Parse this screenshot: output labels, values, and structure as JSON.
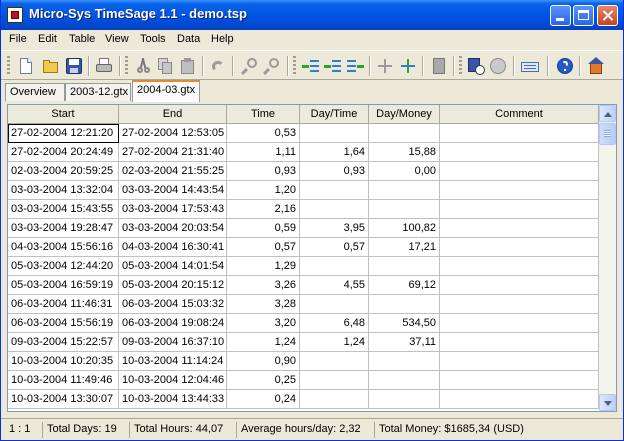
{
  "window": {
    "title": "Micro-Sys TimeSage 1.1 - demo.tsp"
  },
  "menu": [
    "File",
    "Edit",
    "Table",
    "View",
    "Tools",
    "Data",
    "Help"
  ],
  "toolbar": {
    "buttons": [
      "new-file",
      "open-folder",
      "save",
      "print",
      "cut",
      "copy",
      "paste",
      "undo",
      "find",
      "replace",
      "insert-row-before",
      "insert-row",
      "insert-row-after",
      "merge-rows",
      "split-row",
      "notes",
      "calculator-clock",
      "stop",
      "keyboard",
      "help",
      "home"
    ]
  },
  "tabs": [
    {
      "label": "Overview",
      "active": false
    },
    {
      "label": "2003-12.gtx",
      "active": false
    },
    {
      "label": "2004-03.gtx",
      "active": true
    }
  ],
  "table": {
    "columns": [
      "Start",
      "End",
      "Time",
      "Day/Time",
      "Day/Money",
      "Comment"
    ],
    "rows": [
      [
        "27-02-2004 12:21:20",
        "27-02-2004 12:53:05",
        "0,53",
        "",
        "",
        ""
      ],
      [
        "27-02-2004 20:24:49",
        "27-02-2004 21:31:40",
        "1,11",
        "1,64",
        "15,88",
        ""
      ],
      [
        "02-03-2004 20:59:25",
        "02-03-2004 21:55:25",
        "0,93",
        "0,93",
        "0,00",
        ""
      ],
      [
        "03-03-2004 13:32:04",
        "03-03-2004 14:43:54",
        "1,20",
        "",
        "",
        ""
      ],
      [
        "03-03-2004 15:43:55",
        "03-03-2004 17:53:43",
        "2,16",
        "",
        "",
        ""
      ],
      [
        "03-03-2004 19:28:47",
        "03-03-2004 20:03:54",
        "0,59",
        "3,95",
        "100,82",
        ""
      ],
      [
        "04-03-2004 15:56:16",
        "04-03-2004 16:30:41",
        "0,57",
        "0,57",
        "17,21",
        ""
      ],
      [
        "05-03-2004 12:44:20",
        "05-03-2004 14:01:54",
        "1,29",
        "",
        "",
        ""
      ],
      [
        "05-03-2004 16:59:19",
        "05-03-2004 20:15:12",
        "3,26",
        "4,55",
        "69,12",
        ""
      ],
      [
        "06-03-2004 11:46:31",
        "06-03-2004 15:03:32",
        "3,28",
        "",
        "",
        ""
      ],
      [
        "06-03-2004 15:56:19",
        "06-03-2004 19:08:24",
        "3,20",
        "6,48",
        "534,50",
        ""
      ],
      [
        "09-03-2004 15:22:57",
        "09-03-2004 16:37:10",
        "1,24",
        "1,24",
        "37,11",
        ""
      ],
      [
        "10-03-2004 10:20:35",
        "10-03-2004 11:14:24",
        "0,90",
        "",
        "",
        ""
      ],
      [
        "10-03-2004 11:49:46",
        "10-03-2004 12:04:46",
        "0,25",
        "",
        "",
        ""
      ],
      [
        "10-03-2004 13:30:07",
        "10-03-2004 13:44:33",
        "0,24",
        "",
        "",
        ""
      ]
    ]
  },
  "status": {
    "position": "1 : 1",
    "total_days": "Total Days: 19",
    "total_hours": "Total Hours: 44,07",
    "average": "Average hours/day: 2,32",
    "total_money": "Total Money: $1685,34 (USD)"
  }
}
